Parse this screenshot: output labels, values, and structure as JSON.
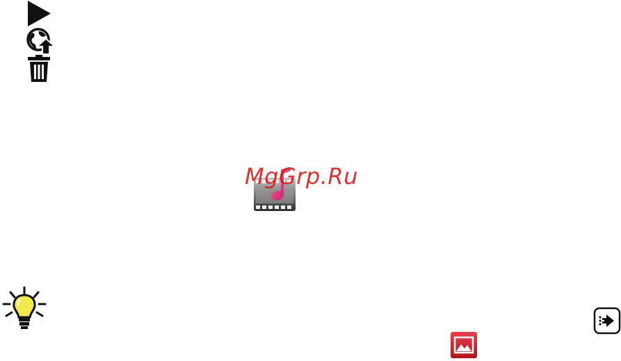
{
  "page": {
    "watermark": "MgGrp.Ru"
  },
  "icons": {
    "play": "play-icon",
    "share_online": "globe-upload-icon",
    "delete": "trash-icon",
    "media": "film-music-icon",
    "tip": "lightbulb-icon",
    "gallery": "photo-gallery-icon",
    "forward": "forward-arrow-icon"
  },
  "colors": {
    "icon_black": "#111111",
    "watermark_red": "#dc1414",
    "music_pink": "#e3247a",
    "gallery_red": "#d21f26",
    "bulb_yellow": "#f2e94a"
  }
}
